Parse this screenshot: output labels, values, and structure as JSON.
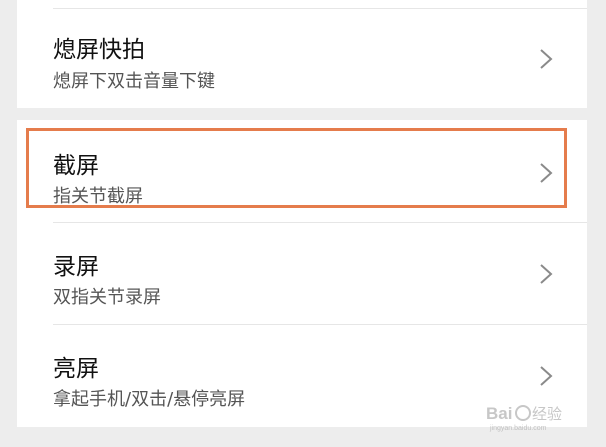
{
  "settings": {
    "items": [
      {
        "title": "熄屏快拍",
        "subtitle": "熄屏下双击音量下键"
      },
      {
        "title": "截屏",
        "subtitle": "指关节截屏"
      },
      {
        "title": "录屏",
        "subtitle": "双指关节录屏"
      },
      {
        "title": "亮屏",
        "subtitle": "拿起手机/双击/悬停亮屏"
      }
    ]
  },
  "watermark": {
    "text": "Baidu经验",
    "subtext": "jingyan.baidu.com"
  },
  "colors": {
    "highlight": "#e57c4c",
    "background": "#ededed",
    "card": "#ffffff"
  },
  "icons": {
    "row_arrow": "chevron-right-icon"
  }
}
